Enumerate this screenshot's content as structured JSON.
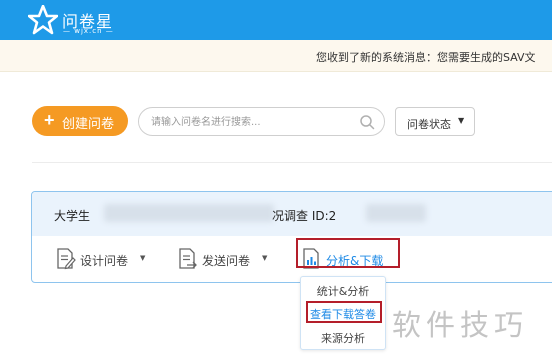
{
  "header": {
    "logo_name": "问卷星",
    "logo_domain": "— wjx.cn —"
  },
  "notice": {
    "text": "您收到了新的系统消息：您需要生成的SAV文"
  },
  "toolbar": {
    "create_label": "创建问卷",
    "search_placeholder": "请输入问卷名进行搜索...",
    "status_label": "问卷状态"
  },
  "survey": {
    "title_prefix": "大学生",
    "title_suffix": "况调查  ID:2",
    "actions": {
      "design": "设计问卷",
      "send": "发送问卷",
      "analyze": "分析&下载"
    }
  },
  "dropdown": {
    "items": [
      "统计&分析",
      "查看下载答卷",
      "来源分析"
    ]
  },
  "watermark": {
    "text": "软件技巧"
  },
  "colors": {
    "header_blue": "#1e9ae8",
    "accent_orange": "#f59a23",
    "link_blue": "#1e8ae6",
    "highlight_red": "#b41e2a"
  }
}
